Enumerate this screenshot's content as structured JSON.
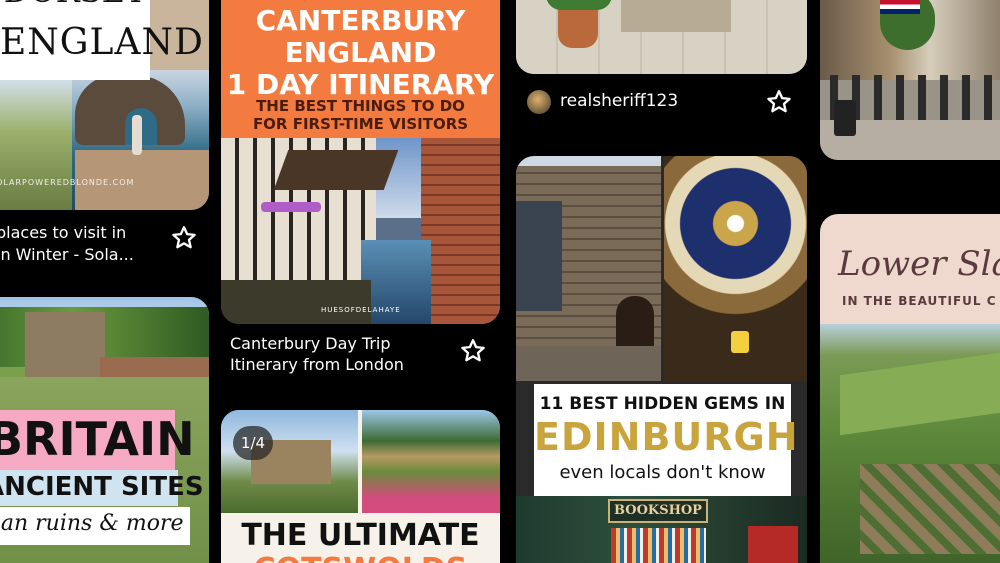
{
  "pins": {
    "dorset": {
      "title_line1": "DORSET",
      "title_line2": "ENGLAND",
      "watermark": "SOLARPOWEREDBLONDE.COM",
      "caption_line1": "places to visit in",
      "caption_line2": "in Winter - Sola..."
    },
    "britain": {
      "line1": "BRITAIN",
      "line2": "ANCIENT SITES",
      "line3": "man ruins & more"
    },
    "canterbury": {
      "title_line1": "CANTERBURY",
      "title_line2": "ENGLAND",
      "title_line3": "1 DAY ITINERARY",
      "sub_line1": "THE BEST THINGS TO DO",
      "sub_line2": "FOR FIRST-TIME VISITORS",
      "watermark": "HUESOFDELAHAYE",
      "caption_line1": "Canterbury Day Trip",
      "caption_line2": "Itinerary from London"
    },
    "cotswolds": {
      "counter": "1/4",
      "line1": "THE ULTIMATE",
      "line2": "COTSWOLDS"
    },
    "realsheriff": {
      "username": "realsheriff123"
    },
    "edinburgh": {
      "line1": "11 BEST HIDDEN GEMS IN",
      "line2": "EDINBURGH",
      "line3": "even locals don't know",
      "bookshop": "BOOKSHOP"
    },
    "slaughter": {
      "title": "Lower Sla",
      "subtitle": "IN THE BEAUTIFUL C"
    }
  },
  "colors": {
    "accent_orange": "#f47b3f",
    "edinburgh_gold": "#c9a43c",
    "britain_pink": "#f6a9c3",
    "slaughter_bg": "#efd9cf",
    "slaughter_title": "#5b3a3f"
  }
}
